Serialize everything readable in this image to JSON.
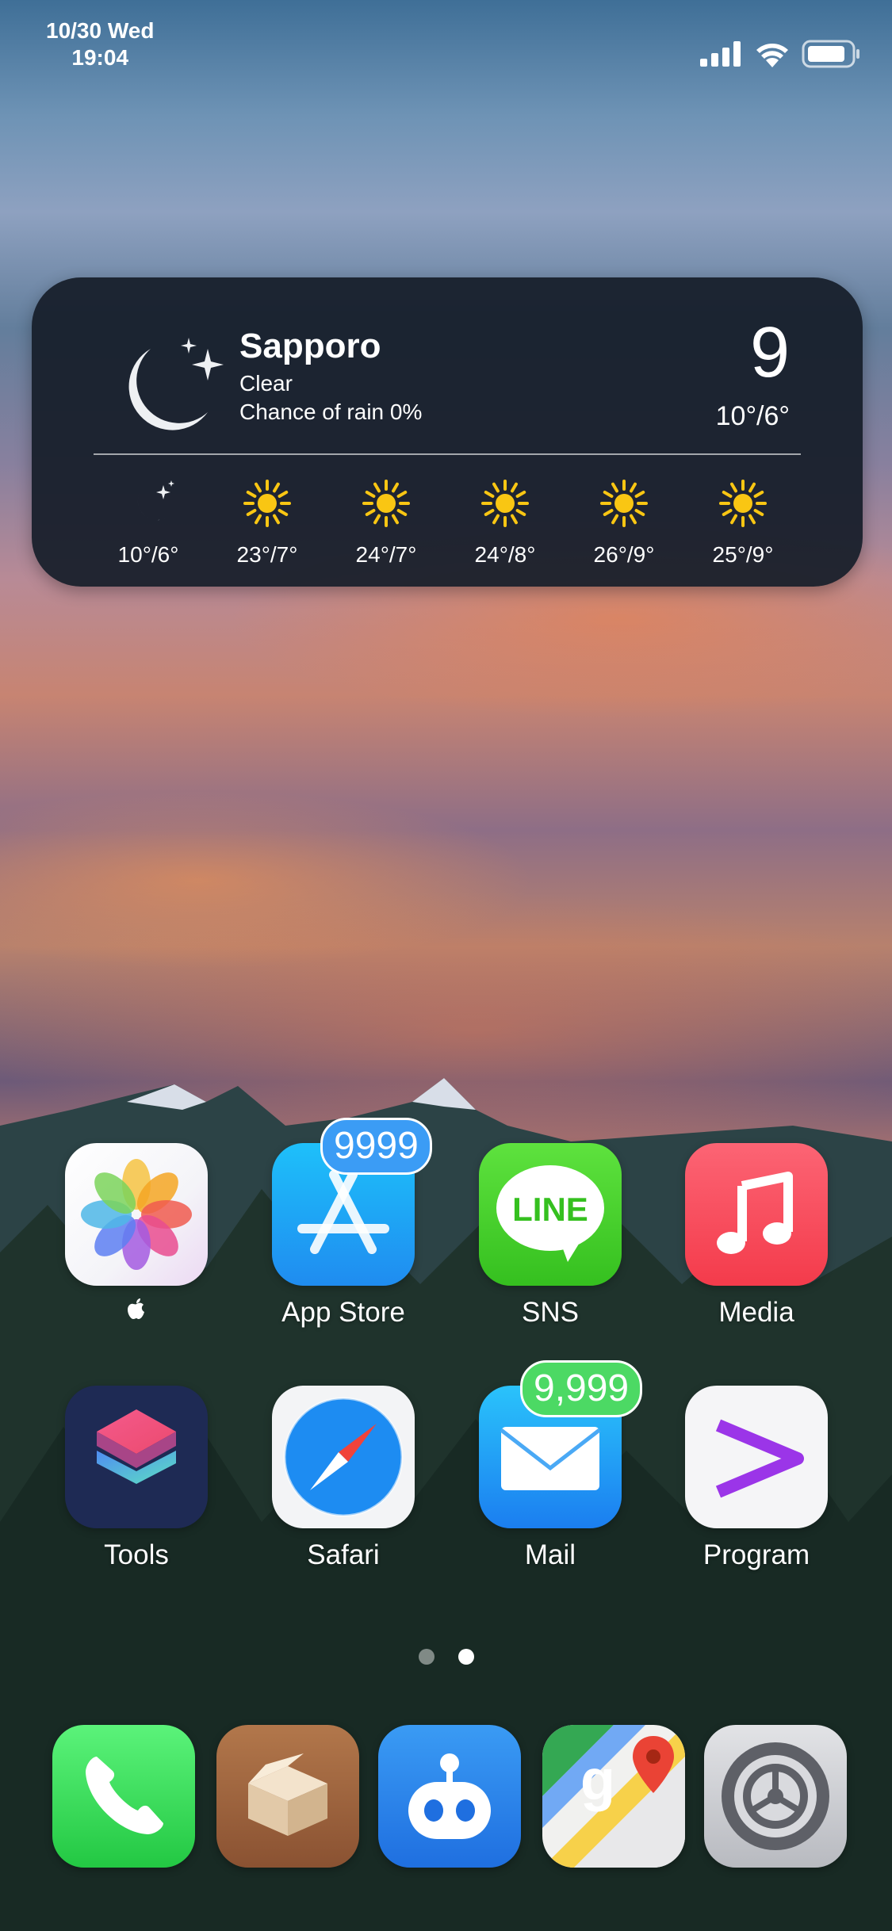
{
  "status_bar": {
    "date": "10/30 Wed",
    "time": "19:04"
  },
  "weather": {
    "city": "Sapporo",
    "condition": "Clear",
    "rain": "Chance of rain 0%",
    "temp": "9",
    "range": "10°/6°",
    "forecast": [
      {
        "icon": "moon-stars-icon",
        "temps": "10°/6°"
      },
      {
        "icon": "sun-icon",
        "temps": "23°/7°"
      },
      {
        "icon": "sun-icon",
        "temps": "24°/7°"
      },
      {
        "icon": "sun-icon",
        "temps": "24°/8°"
      },
      {
        "icon": "sun-icon",
        "temps": "26°/9°"
      },
      {
        "icon": "sun-icon",
        "temps": "25°/9°"
      }
    ]
  },
  "apps": [
    {
      "label": "",
      "icon": "photos-icon"
    },
    {
      "label": "App Store",
      "icon": "app-store-icon",
      "badge": "9999"
    },
    {
      "label": "SNS",
      "icon": "line-icon",
      "icon_text": "LINE"
    },
    {
      "label": "Media",
      "icon": "music-icon"
    },
    {
      "label": "Tools",
      "icon": "shortcuts-icon"
    },
    {
      "label": "Safari",
      "icon": "safari-icon"
    },
    {
      "label": "Mail",
      "icon": "mail-icon",
      "badge": "9,999"
    },
    {
      "label": "Program",
      "icon": "program-icon"
    }
  ],
  "page_indicator": {
    "total": 2,
    "current": 2
  },
  "dock": [
    {
      "icon": "phone-icon"
    },
    {
      "icon": "cydia-icon"
    },
    {
      "icon": "robot-icon"
    },
    {
      "icon": "google-maps-icon"
    },
    {
      "icon": "settings-gear-icon"
    }
  ],
  "colors": {
    "badge_blue": "#3b9cf5",
    "badge_green": "#4cd964"
  }
}
